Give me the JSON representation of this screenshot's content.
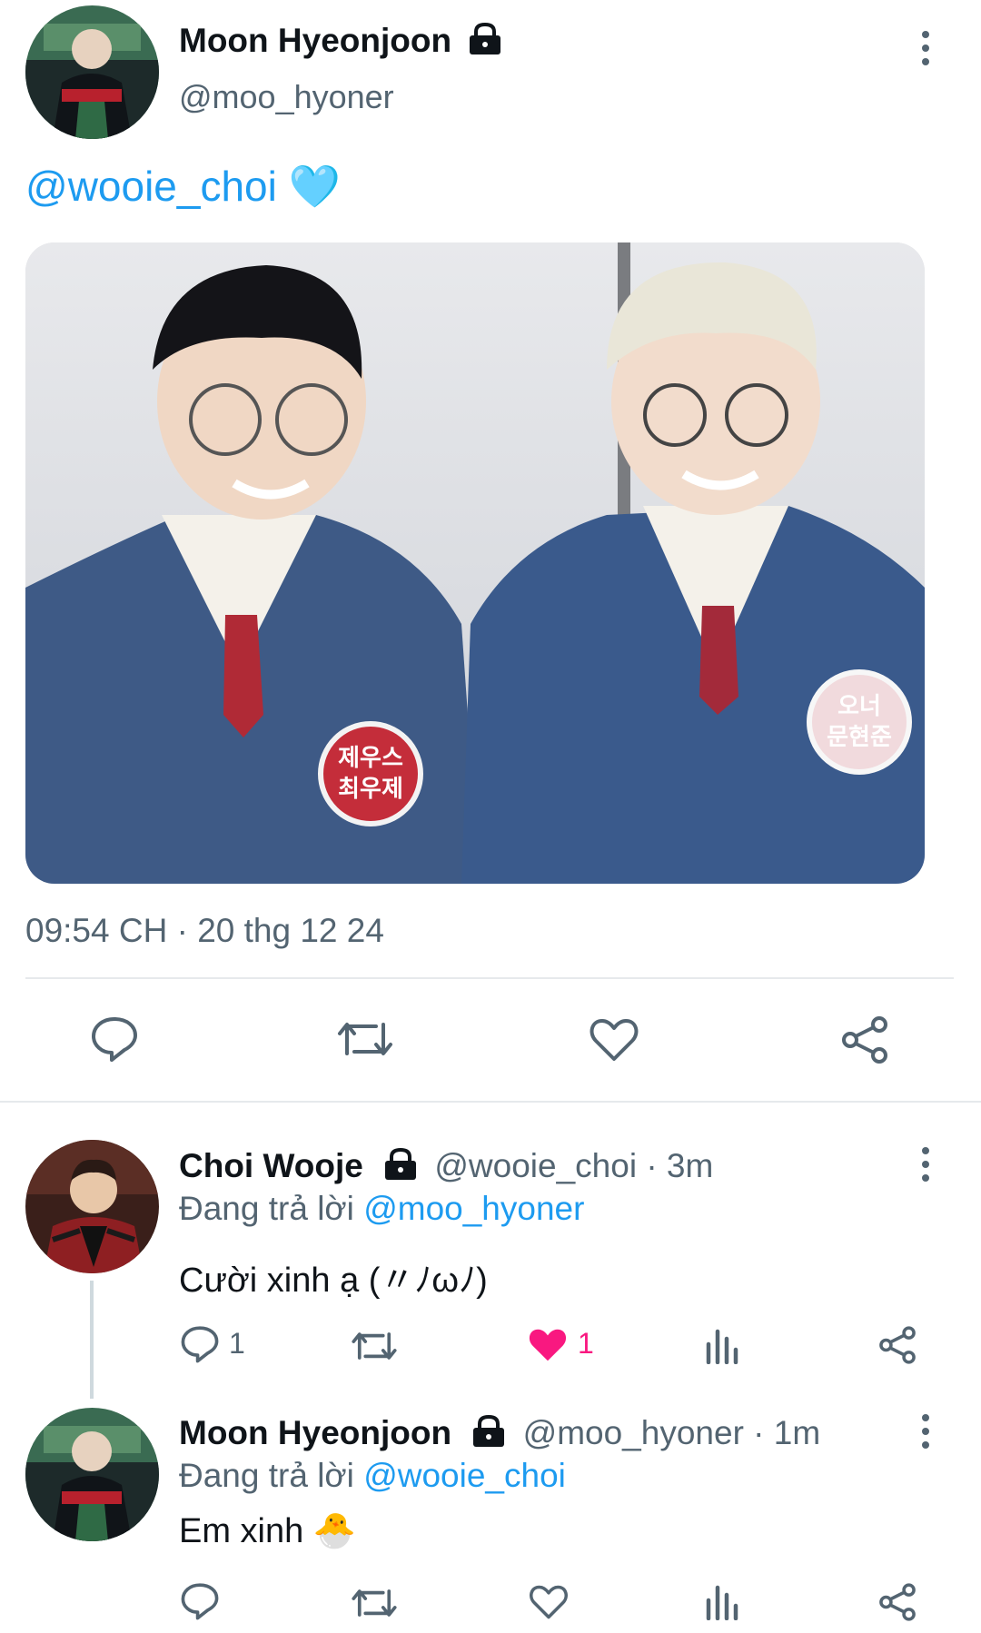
{
  "main_tweet": {
    "author_name": "Moon Hyeonjoon",
    "author_handle": "@moo_hyoner",
    "mention": "@wooie_choi",
    "emoji": "🩵",
    "timestamp": "09:54 CH · 20 thg 12 24",
    "photo_badges": {
      "left_top": "제우스",
      "left_bottom": "최우제",
      "right_top": "오너",
      "right_bottom": "문현준"
    }
  },
  "replies": [
    {
      "author_name": "Choi Wooje",
      "meta": "@wooie_choi · 3m",
      "replying_prefix": "Đang trả lời",
      "replying_to": "@moo_hyoner",
      "text": "Cười xinh ạ (〃ﾉωﾉ)",
      "reply_count": "1",
      "like_count": "1",
      "liked": true
    },
    {
      "author_name": "Moon Hyeonjoon",
      "meta": "@moo_hyoner · 1m",
      "replying_prefix": "Đang trả lời",
      "replying_to": "@wooie_choi",
      "text": "Em xinh",
      "emoji": "🐣",
      "reply_count": "",
      "like_count": "",
      "liked": false
    }
  ],
  "colors": {
    "accent": "#1d9bf0",
    "like": "#f91880",
    "icon": "#536471"
  }
}
